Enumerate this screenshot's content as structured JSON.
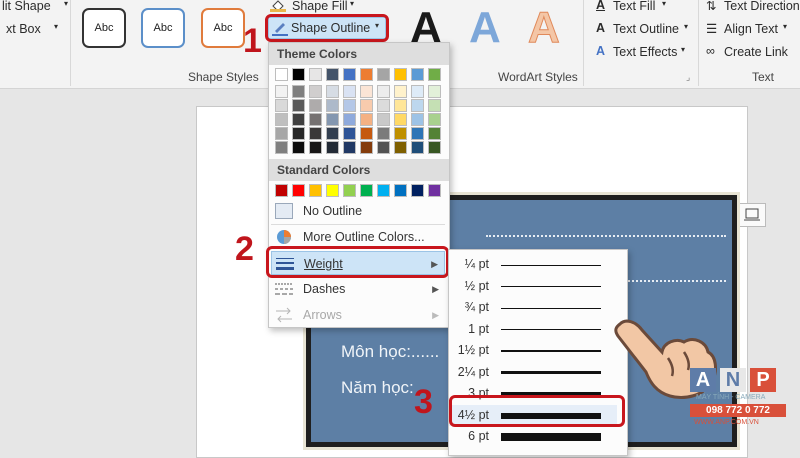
{
  "ribbon": {
    "shape_fill_left": "lit Shape",
    "text_box_left": "xt Box",
    "shape_fill": "Shape Fill",
    "shape_outline": "Shape Outline",
    "shape_styles_label": "Shape Styles",
    "style_samples": [
      "Abc",
      "Abc",
      "Abc"
    ],
    "wordart_letters": [
      "A",
      "A",
      "A"
    ],
    "wordart_styles_label": "WordArt Styles",
    "text_fill": "Text Fill",
    "text_outline": "Text Outline",
    "text_effects": "Text Effects",
    "text_direction": "Text Direction",
    "align_text": "Align Text",
    "create_link": "Create Link",
    "text_group_label": "Text"
  },
  "outline_menu": {
    "theme_colors_title": "Theme Colors",
    "standard_colors_title": "Standard Colors",
    "theme_top_row": [
      "#ffffff",
      "#000000",
      "#e7e6e6",
      "#44546a",
      "#4472c4",
      "#ed7d31",
      "#a5a5a5",
      "#ffc000",
      "#5b9bd5",
      "#70ad47"
    ],
    "theme_shades": [
      [
        "#f2f2f2",
        "#7f7f7f",
        "#d0cece",
        "#d6dce4",
        "#d9e2f3",
        "#fbe5d6",
        "#ededed",
        "#fff2cc",
        "#deebf7",
        "#e2f0d9"
      ],
      [
        "#d9d9d9",
        "#595959",
        "#aeabab",
        "#adb9ca",
        "#b4c7e7",
        "#f8cbad",
        "#dbdbdb",
        "#ffe699",
        "#bdd7ee",
        "#c5e0b4"
      ],
      [
        "#bfbfbf",
        "#404040",
        "#757171",
        "#8497b0",
        "#8faadc",
        "#f4b183",
        "#c9c9c9",
        "#ffd966",
        "#9dc3e6",
        "#a9d18e"
      ],
      [
        "#a6a6a6",
        "#262626",
        "#3a3838",
        "#333f50",
        "#2f5597",
        "#c55a11",
        "#7b7b7b",
        "#bf9000",
        "#2e75b6",
        "#548235"
      ],
      [
        "#7f7f7f",
        "#0d0d0d",
        "#171616",
        "#222a35",
        "#203864",
        "#843c0c",
        "#525252",
        "#7f6000",
        "#1f4e79",
        "#385723"
      ]
    ],
    "standard": [
      "#c00000",
      "#ff0000",
      "#ffc000",
      "#ffff00",
      "#92d050",
      "#00b050",
      "#00b0f0",
      "#0070c0",
      "#002060",
      "#7030a0"
    ],
    "no_outline": "No Outline",
    "more_colors": "More Outline Colors...",
    "weight": "Weight",
    "dashes": "Dashes",
    "arrows": "Arrows"
  },
  "weight_menu": {
    "items": [
      {
        "label": "¼ pt",
        "thickness": 0.25
      },
      {
        "label": "½ pt",
        "thickness": 0.5
      },
      {
        "label": "¾ pt",
        "thickness": 0.75
      },
      {
        "label": "1 pt",
        "thickness": 1
      },
      {
        "label": "1½ pt",
        "thickness": 1.5
      },
      {
        "label": "2¼ pt",
        "thickness": 2.25
      },
      {
        "label": "3 pt",
        "thickness": 3
      },
      {
        "label": "4½ pt",
        "thickness": 4.5
      },
      {
        "label": "6 pt",
        "thickness": 6
      }
    ]
  },
  "slide": {
    "line1": "Môn học:......",
    "line2": "Năm học:"
  },
  "steps": [
    "1",
    "2",
    "3"
  ],
  "watermark": {
    "letters": [
      "A",
      "N",
      "P"
    ],
    "tagline": "MÁY TÍNH - CAMERA",
    "phone": "098 772 0 772",
    "site": "WWW.ANP.COM.VN"
  }
}
